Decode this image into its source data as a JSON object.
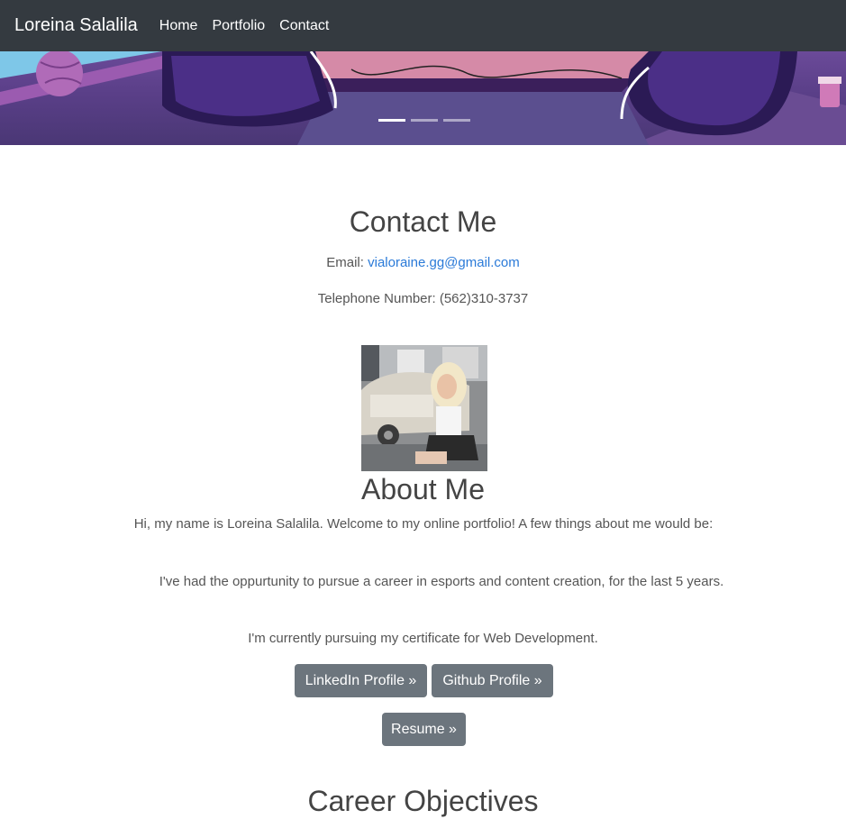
{
  "navbar": {
    "brand": "Loreina Salalila",
    "links": [
      "Home",
      "Portfolio",
      "Contact"
    ]
  },
  "carousel": {
    "slide_count": 3,
    "active_index": 0
  },
  "contact": {
    "title": "Contact Me",
    "email_label": "Email:",
    "email": "vialoraine.gg@gmail.com",
    "phone_line": "Telephone Number: (562)310-3737"
  },
  "about": {
    "title": "About Me",
    "intro": "Hi, my name is Loreina Salalila. Welcome to my online portfolio! A few things about me would be:",
    "p1": "I've had the oppurtunity to pursue a career in esports and content creation, for the last 5 years.",
    "p2": "I'm currently pursuing my certificate for Web Development."
  },
  "buttons": {
    "linkedin": "LinkedIn Profile »",
    "github": "Github Profile »",
    "resume": "Resume »",
    "color": "#6c757d"
  },
  "career": {
    "title": "Career Objectives"
  },
  "colors": {
    "navbar": "#343a40",
    "link": "#2a7ad8",
    "hero": "#5a3f88"
  }
}
